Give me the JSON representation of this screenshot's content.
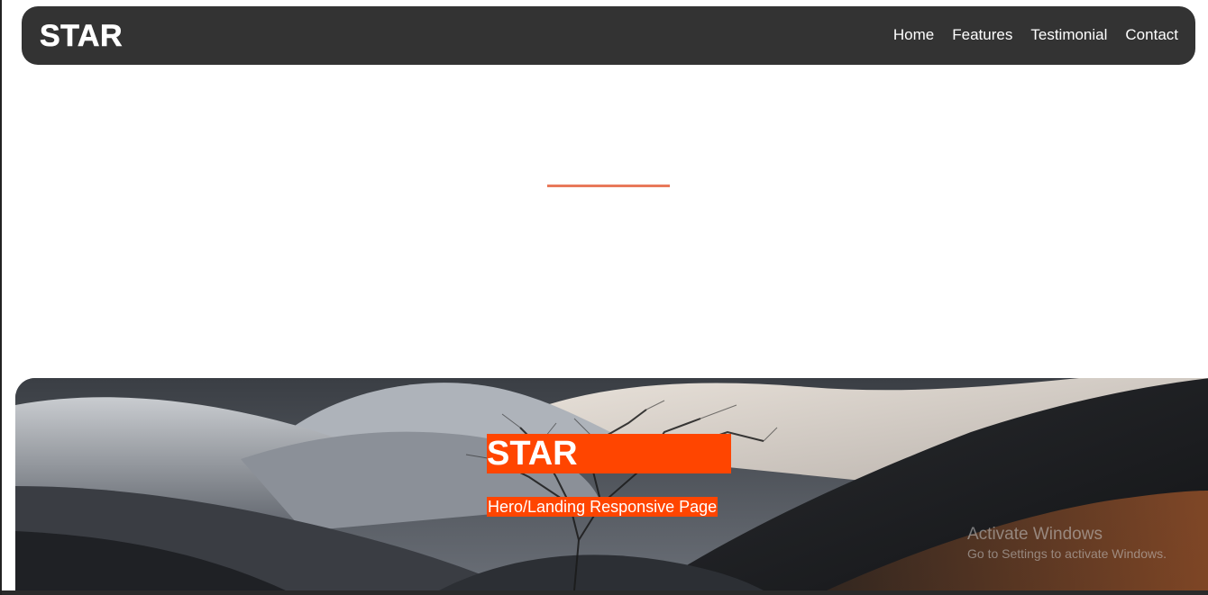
{
  "navbar": {
    "logo": "STAR",
    "links": [
      {
        "label": "Home"
      },
      {
        "label": "Features"
      },
      {
        "label": "Testimonial"
      },
      {
        "label": "Contact"
      }
    ]
  },
  "hero": {
    "title": "STAR",
    "subtitle": "Hero/Landing Responsive Page"
  },
  "watermark": {
    "title": "Activate Windows",
    "subtitle": "Go to Settings to activate Windows."
  },
  "colors": {
    "navbar_bg": "#333333",
    "accent": "#ff4500",
    "divider": "#e8795a"
  }
}
